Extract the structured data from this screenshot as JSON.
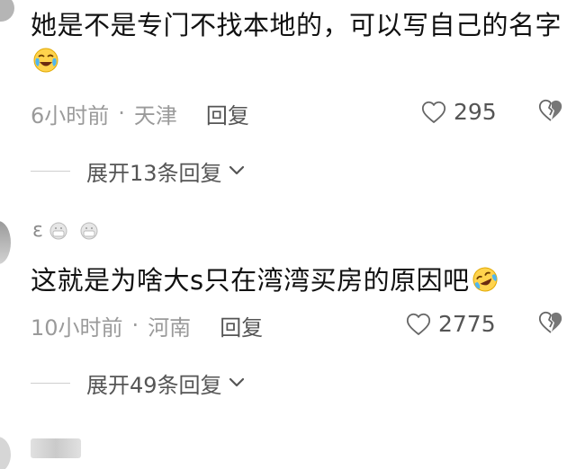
{
  "comments": [
    {
      "text": "她是不是专门不找本地的，可以写自己的名字",
      "emoji": "crying-laughing-face",
      "time": "6小时前",
      "location": "天津",
      "reply_label": "回复",
      "likes": "295",
      "expand_label": "展开13条回复"
    },
    {
      "username_hint": "ε",
      "text": "这就是为啥大s只在湾湾买房的原因吧",
      "emoji": "rolling-laughing-face",
      "time": "10小时前",
      "location": "河南",
      "reply_label": "回复",
      "likes": "2775",
      "expand_label": "展开49条回复"
    }
  ],
  "separator_dot": "·",
  "icons": {
    "like": "heart-outline-icon",
    "dislike": "broken-heart-icon",
    "expand": "chevron-down-icon"
  },
  "colors": {
    "text": "#111111",
    "meta": "#9a9a9a",
    "action": "#555555"
  }
}
